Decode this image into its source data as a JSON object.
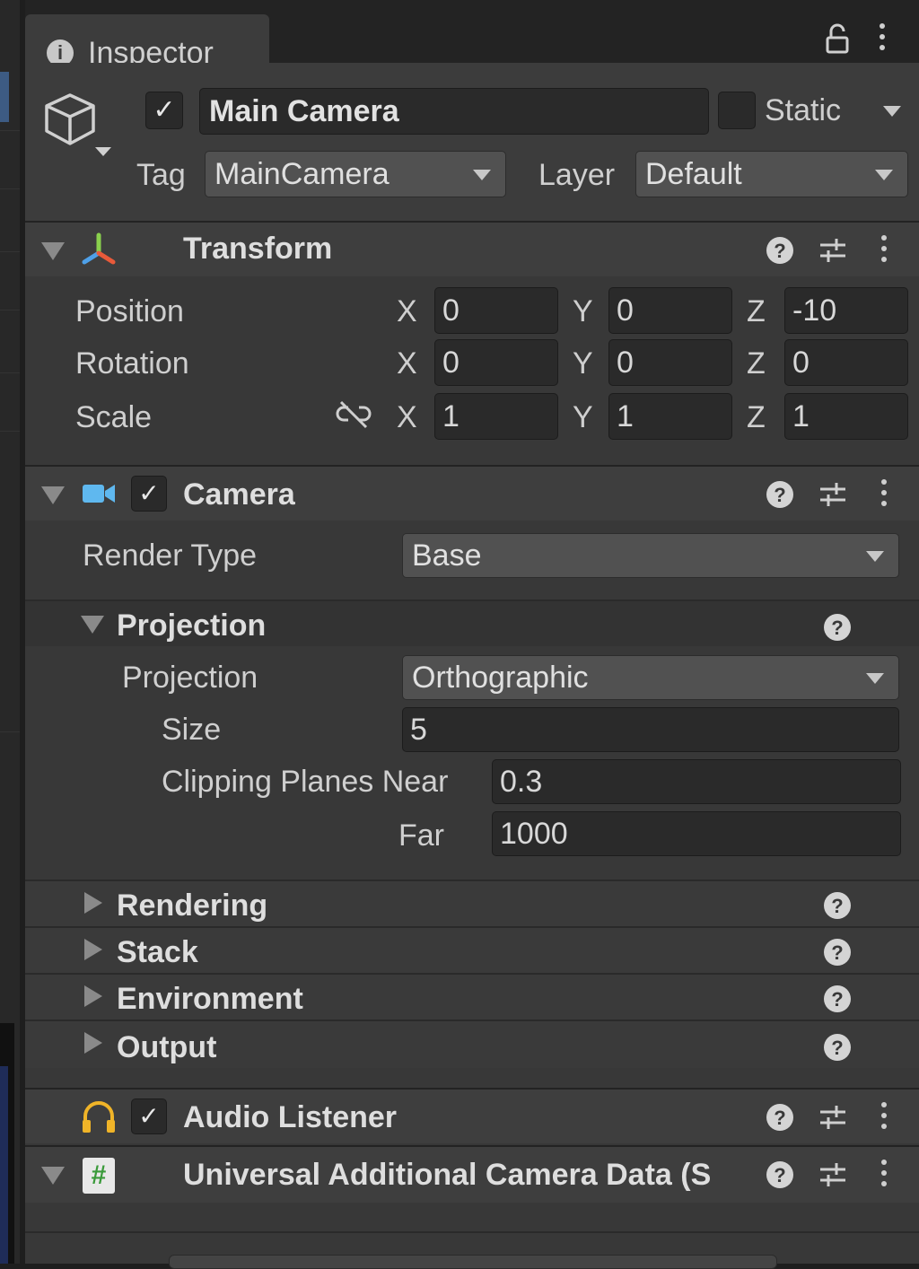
{
  "tab": {
    "title": "Inspector"
  },
  "gameobject": {
    "name": "Main Camera",
    "active_checked": true,
    "static_label": "Static",
    "tag_label": "Tag",
    "tag_value": "MainCamera",
    "layer_label": "Layer",
    "layer_value": "Default"
  },
  "transform": {
    "title": "Transform",
    "rows": [
      {
        "label": "Position",
        "x": "0",
        "y": "0",
        "z": "-10"
      },
      {
        "label": "Rotation",
        "x": "0",
        "y": "0",
        "z": "0"
      },
      {
        "label": "Scale",
        "x": "1",
        "y": "1",
        "z": "1"
      }
    ],
    "axis": {
      "x": "X",
      "y": "Y",
      "z": "Z"
    }
  },
  "camera": {
    "title": "Camera",
    "render_type_label": "Render Type",
    "render_type_value": "Base",
    "projection_section": "Projection",
    "projection_label": "Projection",
    "projection_value": "Orthographic",
    "size_label": "Size",
    "size_value": "5",
    "clipping_label": "Clipping Planes Near",
    "near_value": "0.3",
    "far_label": "Far",
    "far_value": "1000",
    "sections": [
      "Rendering",
      "Stack",
      "Environment",
      "Output"
    ]
  },
  "audio_listener": {
    "title": "Audio Listener"
  },
  "additional_data": {
    "title": "Universal Additional Camera Data (S"
  },
  "icons": {
    "info": "info-icon",
    "lock": "lock-icon",
    "menu": "kebab-menu-icon",
    "gameobject": "cube-icon",
    "transform": "transform-axes-icon",
    "camera": "camera-icon",
    "audio": "headphones-icon",
    "script": "script-hash-icon",
    "help": "help-icon",
    "presets": "presets-sliders-icon",
    "link": "unlinked-scale-icon"
  },
  "colors": {
    "background": "#383838",
    "header": "#3e3e3e",
    "field": "#2a2a2a",
    "dropdown": "#515151"
  }
}
